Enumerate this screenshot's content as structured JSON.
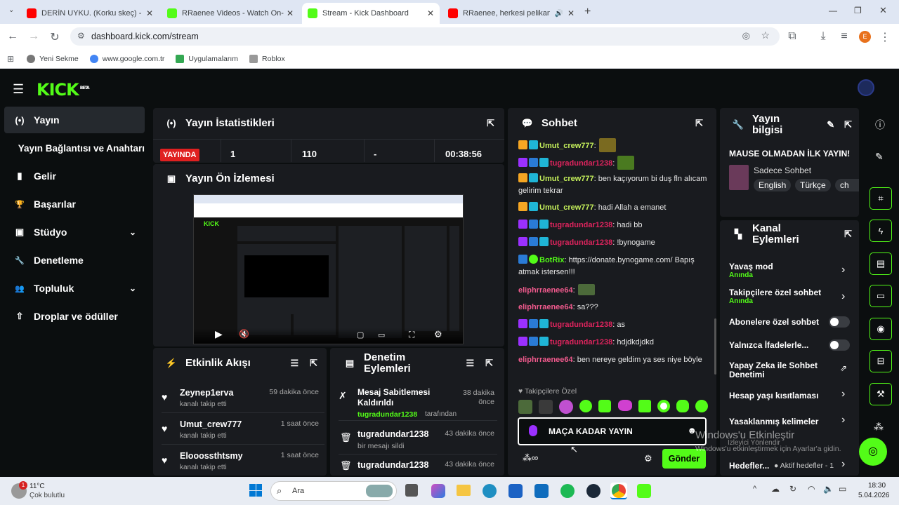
{
  "browser": {
    "tabs": [
      {
        "title": "DERİN UYKU. (Korku skeç) - Yo",
        "color": "#ff0000"
      },
      {
        "title": "RRaenee Videos - Watch On-De",
        "color": "#53fc18"
      },
      {
        "title": "Stream - Kick Dashboard",
        "color": "#53fc18"
      },
      {
        "title": "RRaenee, herkesi pelikanda",
        "color": "#ff0000"
      }
    ],
    "url": "dashboard.kick.com/stream",
    "bookmarks": [
      "Yeni Sekme",
      "www.google.com.tr",
      "Uygulamalarım",
      "Roblox"
    ],
    "profile_initial": "E"
  },
  "app": {
    "logo": "KICK",
    "logo_badge": "BETA",
    "nav": [
      {
        "label": "Yayın",
        "icon": "(•)"
      },
      {
        "label": "Yayın Bağlantısı ve Anahtarı",
        "icon": ""
      },
      {
        "label": "Gelir",
        "icon": "▮"
      },
      {
        "label": "Başarılar",
        "icon": "🏆"
      },
      {
        "label": "Stüdyo",
        "icon": "▣"
      },
      {
        "label": "Denetleme",
        "icon": "🔧"
      },
      {
        "label": "Topluluk",
        "icon": "👥"
      },
      {
        "label": "Droplar ve ödüller",
        "icon": "⇧"
      }
    ]
  },
  "stats": {
    "title": "Yayın İstatistikleri",
    "live": "YAYINDA",
    "values": [
      "1",
      "110",
      "-",
      "00:38:56"
    ]
  },
  "preview": {
    "title": "Yayın Ön İzlemesi"
  },
  "events": {
    "title": "Etkinlik Akışı",
    "items": [
      {
        "name": "Zeynep1erva",
        "action": "kanalı takip etti",
        "time": "59 dakika önce"
      },
      {
        "name": "Umut_crew777",
        "action": "kanalı takip etti",
        "time": "1 saat önce"
      },
      {
        "name": "Eloooss​thtsmy",
        "action": "kanalı takip etti",
        "time": "1 saat önce"
      }
    ]
  },
  "moderation": {
    "title": "Denetim Eylemleri",
    "items": [
      {
        "action": "Mesaj Sabitlemesi Kaldırıldı",
        "by": "tugradundar1238",
        "suffix": "tarafından",
        "time": "38 dakika önce"
      },
      {
        "name": "tugradundar1238",
        "action": "bir mesajı sildi",
        "time": "43 dakika önce"
      },
      {
        "name": "tugradundar1238",
        "time": "43 dakika önce"
      }
    ]
  },
  "chat": {
    "title": "Sohbet",
    "messages": [
      {
        "user": "Umut_crew777",
        "cls": "u-g",
        "text": ":"
      },
      {
        "user": "tugradundar1238",
        "cls": "u-r",
        "text": ":"
      },
      {
        "user": "Umut_crew777",
        "cls": "u-g",
        "text": ": ben kaçıyorum bi duş fln alıcam gelirim tekrar"
      },
      {
        "user": "Umut_crew777",
        "cls": "u-g",
        "text": ": hadi Allah a emanet"
      },
      {
        "user": "tugradundar1238",
        "cls": "u-r",
        "text": ": hadi bb"
      },
      {
        "user": "tugradundar1238",
        "cls": "u-r",
        "text": ": !bynogame"
      },
      {
        "user": "BotRix",
        "cls": "u-b",
        "text": ": https://donate.bynogame.com/ Bapış atmak istersen!!!"
      },
      {
        "user": "eliphrraenee64",
        "cls": "u-p",
        "text": ":"
      },
      {
        "user": "eliphrraenee64",
        "cls": "u-p",
        "text": ": sa???"
      },
      {
        "user": "tugradundar1238",
        "cls": "u-r",
        "text": ": as"
      },
      {
        "user": "tugradundar1238",
        "cls": "u-r",
        "text": ": hdjdkdjdkd"
      },
      {
        "user": "eliphrraenee64",
        "cls": "u-p",
        "text": ": ben nereye geldim ya ses niye böyle"
      }
    ],
    "followers_only": "Takipçilere Özel",
    "input_value": "MAÇA KADAR YAYIN",
    "send": "Gönder"
  },
  "stream_info": {
    "title": "Yayın bilgisi",
    "stream_title": "MAUSE OLMADAN İLK YAYIN!",
    "category": "Sadece Sohbet",
    "tags": [
      "English",
      "Türkçe",
      "ch"
    ]
  },
  "channel_actions": {
    "title": "Kanal Eylemleri",
    "items": [
      {
        "label": "Yavaş mod",
        "sub": "Anında"
      },
      {
        "label": "Takipçilere özel sohbet",
        "sub": "Anında"
      },
      {
        "label": "Abonelere özel sohbet",
        "sub": ""
      },
      {
        "label": "Yalnızca İfadelerle...",
        "sub": ""
      },
      {
        "label": "Yapay Zeka ile Sohbet Denetimi",
        "sub": ""
      },
      {
        "label": "Hesap yaşı kısıtlaması",
        "sub": ""
      },
      {
        "label": "Yasaklanmış kelimeler",
        "sub": ""
      },
      {
        "label": "Hedefler...",
        "sub": ""
      }
    ],
    "goals_status": "Aktif hedefler - 1"
  },
  "watermark": {
    "line1": "Windows'u Etkinleştir",
    "line2": "Windows'u etkinleştirmek için Ayarlar'a gidin."
  },
  "overlay_label": "İzleyici Yönlendir",
  "taskbar": {
    "weather_temp": "11°C",
    "weather_desc": "Çok bulutlu",
    "search": "Ara",
    "time": "18:30",
    "date": "5.04.2026",
    "notif_count": "1"
  }
}
